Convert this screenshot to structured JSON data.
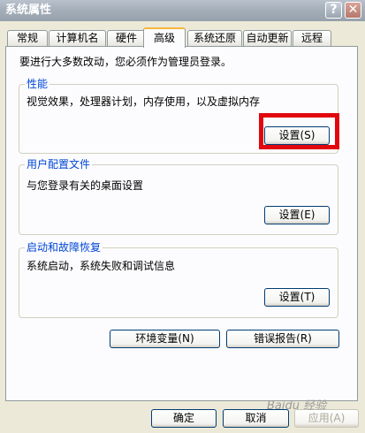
{
  "window": {
    "title": "系统属性",
    "help_glyph": "?",
    "close_glyph": "✕"
  },
  "tabs": [
    "常规",
    "计算机名",
    "硬件",
    "高级",
    "系统还原",
    "自动更新",
    "远程"
  ],
  "intro": "要进行大多数改动，您必须作为管理员登录。",
  "performance": {
    "title": "性能",
    "desc": "视觉效果，处理器计划，内存使用，以及虚拟内存",
    "button": "设置(S)"
  },
  "profile": {
    "title": "用户配置文件",
    "desc": "与您登录有关的桌面设置",
    "button": "设置(E)"
  },
  "startup": {
    "title": "启动和故障恢复",
    "desc": "系统启动，系统失败和调试信息",
    "button": "设置(T)"
  },
  "env_button": "环境变量(N)",
  "error_button": "错误报告(R)",
  "footer": {
    "ok": "确定",
    "cancel": "取消",
    "apply": "应用(A)"
  },
  "watermark": "Baidu 经验",
  "colors": {
    "highlight": "#e2070e",
    "legend": "#0046d5",
    "active_tab_accent": "#f7b53a"
  }
}
